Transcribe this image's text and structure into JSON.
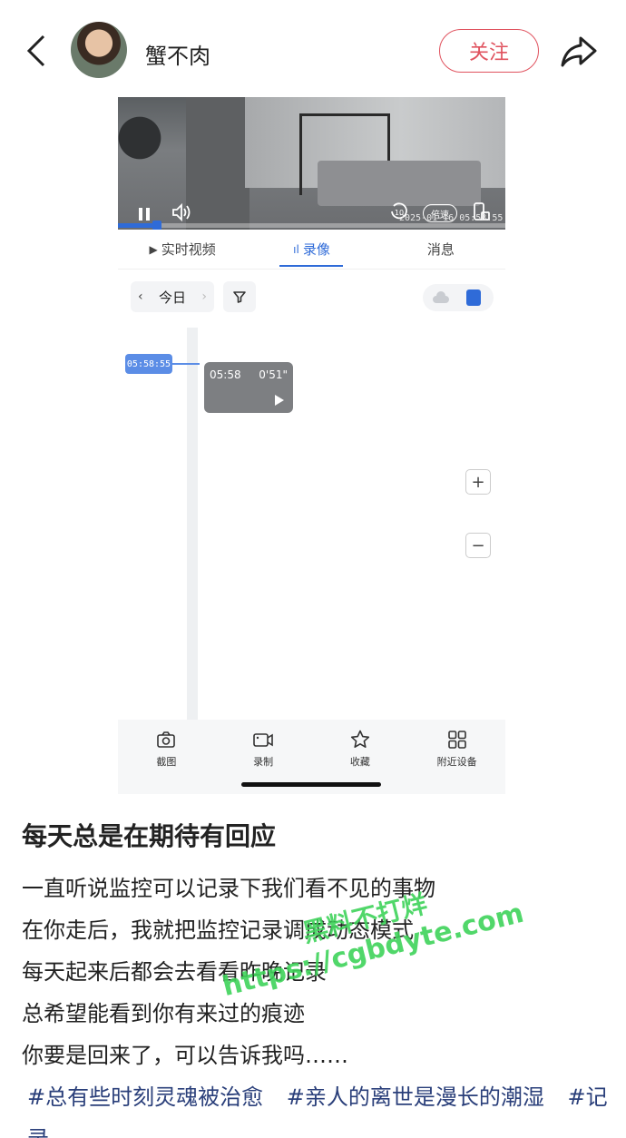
{
  "header": {
    "username": "蟹不肉",
    "follow_label": "关注"
  },
  "video": {
    "timestamp": "2025-01-16 05:58:55",
    "speed_label": "倍速",
    "replay_seconds": "10",
    "progress": 0.1
  },
  "tabs": [
    {
      "label": "实时视频",
      "active": false
    },
    {
      "label": "录像",
      "active": true
    },
    {
      "label": "消息",
      "active": false
    }
  ],
  "filter": {
    "date_label": "今日"
  },
  "timeline": {
    "marker_time": "05:58:55",
    "clip": {
      "start": "05:58",
      "duration": "0'51\""
    }
  },
  "toolbar": [
    {
      "label": "截图",
      "icon": "camera-icon"
    },
    {
      "label": "录制",
      "icon": "video-record-icon"
    },
    {
      "label": "收藏",
      "icon": "star-icon"
    },
    {
      "label": "附近设备",
      "icon": "grid-icon"
    }
  ],
  "post": {
    "title": "每天总是在期待有回应",
    "lines": [
      "一直听说监控可以记录下我们看不见的事物",
      "在你走后，我就把监控记录调成动态模式",
      "每天起来后都会去看看昨晚记录",
      "总希望能看到你有来过的痕迹",
      "你要是回来了，可以告诉我吗……"
    ],
    "hashtags": [
      "#总有些时刻灵魂被治愈",
      "#亲人的离世是漫长的潮湿",
      "#记录"
    ]
  },
  "watermark": {
    "line1": "黑料不打烊",
    "line2": "https://cgbdyte.com"
  },
  "colors": {
    "accent_red": "#e0535f",
    "accent_blue": "#2f6bd8",
    "hashtag": "#2a3f7a",
    "watermark": "#3fd35a"
  }
}
